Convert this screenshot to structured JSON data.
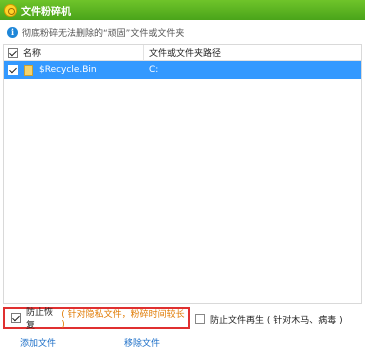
{
  "window": {
    "title": "文件粉碎机"
  },
  "info": {
    "text": "彻底粉碎无法删除的“顽固”文件或文件夹"
  },
  "table": {
    "columns": {
      "name": "名称",
      "path": "文件或文件夹路径"
    },
    "rows": [
      {
        "checked": true,
        "name": "$Recycle.Bin",
        "path": "C:"
      }
    ]
  },
  "options": {
    "prevent_restore": {
      "label": "防止恢复",
      "hint": "( 针对隐私文件，粉碎时间较长 )",
      "checked": true
    },
    "prevent_regen": {
      "label": "防止文件再生 ( 针对木马、病毒 )",
      "checked": false
    }
  },
  "actions": {
    "add_file": "添加文件",
    "remove_file": "移除文件"
  },
  "colors": {
    "titlebar": "#4aa41a",
    "selection": "#3399ff",
    "highlight_border": "#e03030",
    "hint": "#e07a00",
    "link": "#1a6dc7"
  }
}
